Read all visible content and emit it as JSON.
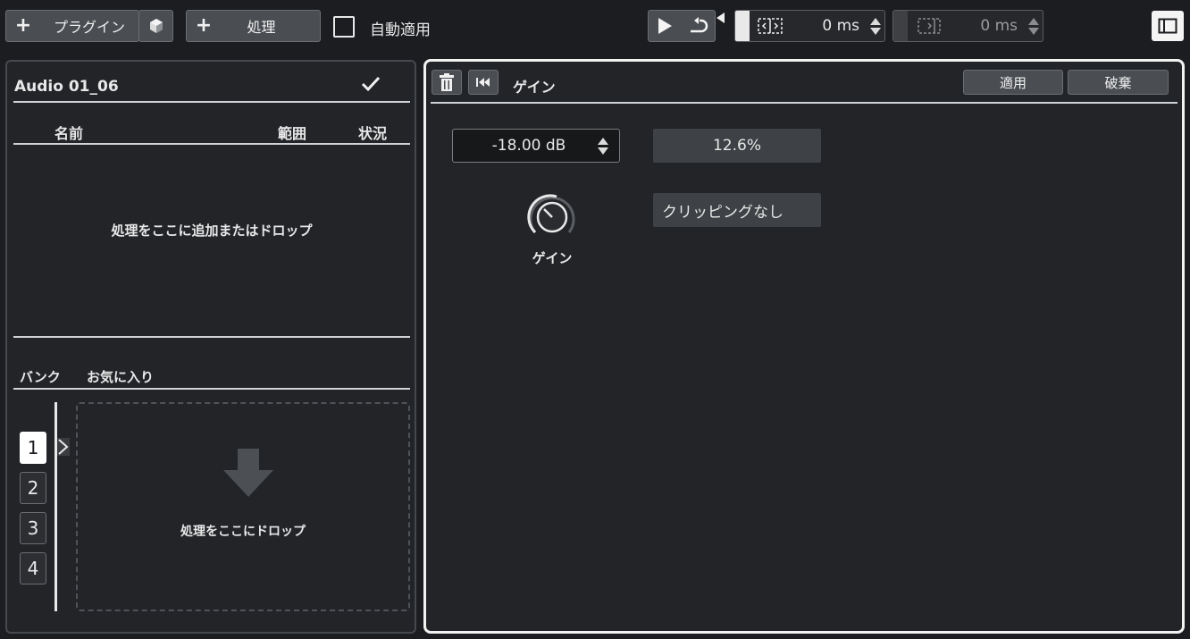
{
  "toolbar": {
    "plugin_label": "プラグイン",
    "process_label": "処理",
    "auto_apply_label": "自動適用",
    "pre_roll_value": "0 ms",
    "post_roll_value": "0 ms"
  },
  "left": {
    "clip_name": "Audio 01_06",
    "columns": {
      "name": "名前",
      "range": "範囲",
      "status": "状況"
    },
    "empty_hint": "処理をここに追加またはドロップ",
    "bank_header": "バンク",
    "favorites_header": "お気に入り",
    "banks": [
      "1",
      "2",
      "3",
      "4"
    ],
    "drop_hint": "処理をここにドロップ"
  },
  "right": {
    "process_title": "ゲイン",
    "apply_label": "適用",
    "discard_label": "破棄",
    "gain_value": "-18.00 dB",
    "percent_value": "12.6%",
    "clipping_status": "クリッピングなし",
    "knob_label": "ゲイン"
  },
  "colors": {
    "background": "#1b1d20",
    "panel": "#222428",
    "button": "#4a4d52",
    "active_border": "#f2f2f2"
  }
}
